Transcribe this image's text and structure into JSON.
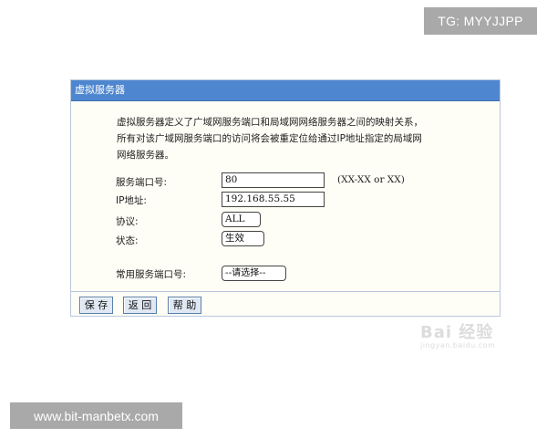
{
  "overlays": {
    "tg_label": "TG: MYYJJPP",
    "url_label": "www.bit-manbetx.com"
  },
  "panel": {
    "title": "虚拟服务器",
    "description": [
      "虚拟服务器定义了广域网服务端口和局域网网络服务器之间的映射关系，",
      "所有对该广域网服务端口的访问将会被重定位给通过IP地址指定的局域网",
      "网络服务器。"
    ],
    "fields": {
      "port_label": "服务端口号:",
      "port_value": "80",
      "port_hint": "(XX-XX or XX)",
      "ip_label": "IP地址:",
      "ip_value": "192.168.55.55",
      "protocol_label": "协议:",
      "protocol_value": "ALL",
      "status_label": "状态:",
      "status_value": "生效",
      "common_port_label": "常用服务端口号:",
      "common_port_value": "--请选择--"
    },
    "buttons": {
      "save": "保 存",
      "back": "返 回",
      "help": "帮 助"
    }
  },
  "watermark": {
    "brand": "Bai 经验",
    "sub": "jingyan.baidu.com"
  },
  "colors": {
    "header": "#4e86cf",
    "panel_bg": "#fffef6",
    "button_bg": "#dfe8f3"
  }
}
